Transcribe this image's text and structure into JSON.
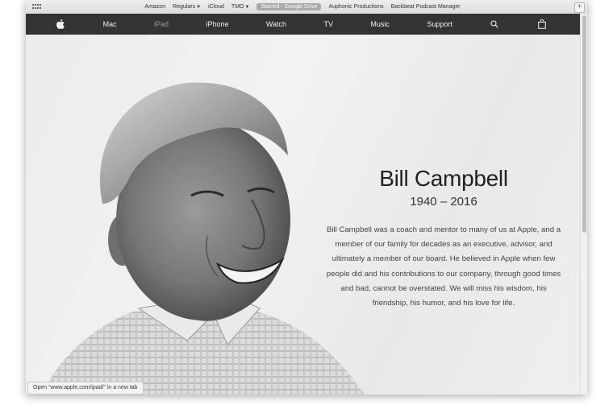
{
  "favorites": {
    "items": [
      {
        "label": "Amazon",
        "dropdown": false
      },
      {
        "label": "Regulars",
        "dropdown": true
      },
      {
        "label": "iCloud",
        "dropdown": false
      },
      {
        "label": "TMO",
        "dropdown": true
      },
      {
        "label": "Starred - Google Drive",
        "dropdown": false,
        "selected": true
      },
      {
        "label": "Auphonic Productions",
        "dropdown": false
      },
      {
        "label": "Backbeat Podcast Manager",
        "dropdown": false
      }
    ],
    "plus_label": "+"
  },
  "globalnav": {
    "items": [
      "Mac",
      "iPad",
      "iPhone",
      "Watch",
      "TV",
      "Music",
      "Support"
    ],
    "current": "iPad",
    "icons": [
      "apple-logo",
      "search-icon",
      "bag-icon"
    ]
  },
  "tribute": {
    "name": "Bill Campbell",
    "years": "1940 – 2016",
    "body": "Bill Campbell was a coach and mentor to many of us at Apple, and a member of our family for decades as an executive, advisor, and ultimately a member of our board. He believed in Apple when few people did and his contributions to our company, through good times and bad, cannot be overstated. We will miss his wisdom, his friendship, his humor, and his love for life."
  },
  "status": {
    "text": "Open “www.apple.com/ipad/” in a new tab"
  },
  "colors": {
    "nav_bg": "#333333",
    "page_bg": "#ececec",
    "text": "#222222"
  }
}
